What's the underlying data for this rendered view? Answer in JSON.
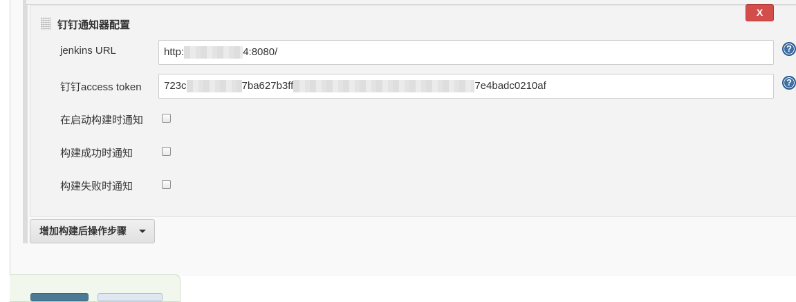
{
  "section": {
    "title": "钉钉通知器配置",
    "delete_label": "X"
  },
  "fields": {
    "jenkins_url": {
      "label": "jenkins URL",
      "value_prefix": "http:",
      "value_suffix": "4:8080/"
    },
    "access_token": {
      "label": "钉钉access token",
      "value_part1": "723c",
      "value_part2": "7ba627b3ff",
      "value_part3": "7e4badc0210af"
    },
    "help_label": "?"
  },
  "checkboxes": [
    {
      "label": "在启动构建时通知",
      "checked": false
    },
    {
      "label": "构建成功时通知",
      "checked": false
    },
    {
      "label": "构建失败时通知",
      "checked": false
    }
  ],
  "add_step_button": {
    "label": "增加构建后操作步骤"
  },
  "colors": {
    "delete_button": "#d34e4a",
    "help_icon": "#3c70a6",
    "save_button": "#4a7a94"
  }
}
